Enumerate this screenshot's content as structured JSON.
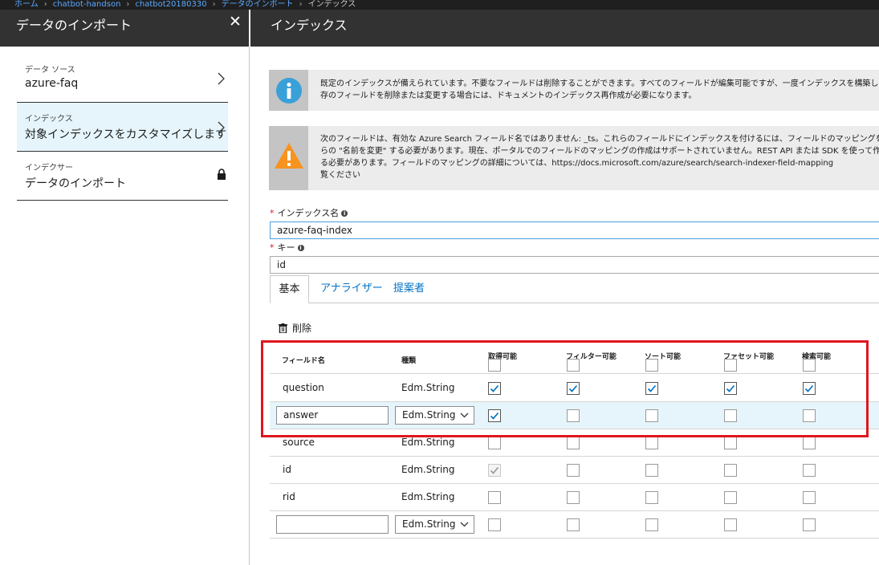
{
  "breadcrumb": [
    "ホーム",
    "chatbot-handson",
    "chatbot20180330",
    "データのインポート",
    "インデックス"
  ],
  "left_panel": {
    "title": "データのインポート",
    "close_glyph": "✕",
    "steps": [
      {
        "small": "データ ソース",
        "main": "azure-faq"
      },
      {
        "small": "インデックス",
        "main": "対象インデックスをカスタマイズします"
      },
      {
        "small": "インデクサー",
        "main": "データのインポート"
      }
    ]
  },
  "right_panel": {
    "title": "インデックス",
    "info_message": {
      "line1": "既定のインデックスが備えられています。不要なフィールドは削除することができます。すべてのフィールドが編集可能ですが、一度インデックスを構築した後",
      "line2": "存のフィールドを削除または変更する場合には、ドキュメントのインデックス再作成が必要になります。"
    },
    "warning_message": {
      "line1": "次のフィールドは、有効な Azure Search フィールド名ではありません: _ts。これらのフィールドにインデックスを付けるには、フィールドのマッピングを使っ",
      "line2": "らの \"名前を変更\" する必要があります。現在、ポータルでのフィールドのマッピングの作成はサポートされていません。REST API または SDK を使って作",
      "line3": "る必要があります。フィールドのマッピングの詳細については、https://docs.microsoft.com/azure/search/search-indexer-field-mapping",
      "line4": "覧ください"
    },
    "index_name_label": "インデックス名",
    "index_name_value": "azure-faq-index",
    "key_label": "キー",
    "key_value": "id",
    "tabs": [
      "基本",
      "アナライザー",
      "提案者"
    ],
    "delete_label": "削除",
    "columns": [
      "フィールド名",
      "種類",
      "取得可能",
      "フィルター可能",
      "ソート可能",
      "ファセット可能",
      "検索可能"
    ],
    "rows": [
      {
        "name": "question",
        "type": "Edm.String",
        "retrievable": true,
        "filterable": true,
        "sortable": true,
        "facetable": true,
        "searchable": true,
        "editable": false,
        "selected": false
      },
      {
        "name": "answer",
        "type": "Edm.String",
        "retrievable": true,
        "filterable": false,
        "sortable": false,
        "facetable": false,
        "searchable": false,
        "editable": true,
        "selected": true
      },
      {
        "name": "source",
        "type": "Edm.String",
        "retrievable": false,
        "filterable": false,
        "sortable": false,
        "facetable": false,
        "searchable": false,
        "editable": false,
        "selected": false
      },
      {
        "name": "id",
        "type": "Edm.String",
        "retrievable": true,
        "retrievable_disabled": true,
        "filterable": false,
        "sortable": false,
        "facetable": false,
        "searchable": false,
        "editable": false,
        "selected": false
      },
      {
        "name": "rid",
        "type": "Edm.String",
        "retrievable": false,
        "filterable": false,
        "sortable": false,
        "facetable": false,
        "searchable": false,
        "editable": false,
        "selected": false
      },
      {
        "name": "",
        "type": "Edm.String",
        "retrievable": false,
        "filterable": false,
        "sortable": false,
        "facetable": false,
        "searchable": false,
        "editable": true,
        "selected": false
      }
    ]
  },
  "colors": {
    "accent": "#0072c6",
    "highlight": "#e0161e",
    "warning": "#f7931e",
    "info": "#3aa0d8"
  },
  "icons": {
    "info": "info-circle-icon",
    "warning": "warning-triangle-icon",
    "lock": "lock-icon",
    "delete": "trash-icon",
    "close": "close-icon"
  }
}
